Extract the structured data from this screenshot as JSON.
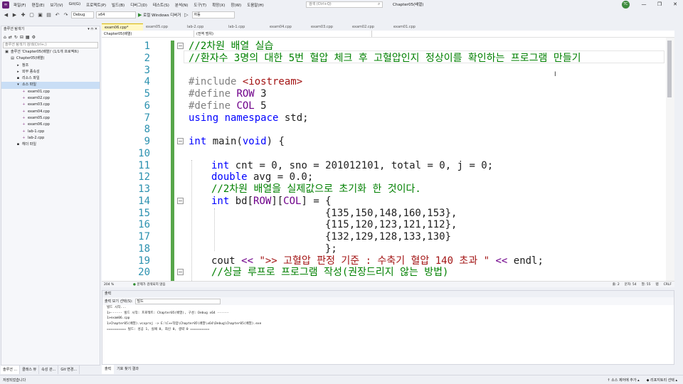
{
  "titlebar": {
    "menus": [
      "파일(F)",
      "편집(E)",
      "보기(V)",
      "Git(G)",
      "프로젝트(P)",
      "빌드(B)",
      "디버그(D)",
      "테스트(S)",
      "분석(N)",
      "도구(T)",
      "확장(X)",
      "창(W)",
      "도움말(H)"
    ],
    "search_placeholder": "검색 (Ctrl+Q)",
    "solution_name": "Chapter05(배열)",
    "avatar": "TC",
    "minimize": "—",
    "maximize": "❐",
    "close": "✕"
  },
  "toolbar": {
    "config": "Debug",
    "platform": "x64",
    "run_label": "로컬 Windows 디버거",
    "mode": "자동"
  },
  "explorer": {
    "title": "솔루션 탐색기",
    "search_placeholder": "솔루션 탐색기 검색(Ctrl+;)",
    "items": [
      {
        "label": "솔루션 'Chapter05(배열)' (1/1개 프로젝트)",
        "icon": "▣",
        "indent": 0,
        "selected": false
      },
      {
        "label": "Chapter05(배열)",
        "icon": "▤",
        "indent": 1,
        "selected": false
      },
      {
        "label": "참조",
        "icon": "▸",
        "indent": 2,
        "selected": false
      },
      {
        "label": "외부 종속성",
        "icon": "▸",
        "indent": 2,
        "selected": false
      },
      {
        "label": "리소스 파일",
        "icon": "▪",
        "indent": 2,
        "selected": false
      },
      {
        "label": "소스 파일",
        "icon": "▾",
        "indent": 2,
        "selected": true
      },
      {
        "label": "exam01.cpp",
        "icon": "+",
        "indent": 3,
        "selected": false
      },
      {
        "label": "exam02.cpp",
        "icon": "+",
        "indent": 3,
        "selected": false
      },
      {
        "label": "exam03.cpp",
        "icon": "+",
        "indent": 3,
        "selected": false
      },
      {
        "label": "exam04.cpp",
        "icon": "+",
        "indent": 3,
        "selected": false
      },
      {
        "label": "exam05.cpp",
        "icon": "+",
        "indent": 3,
        "selected": false
      },
      {
        "label": "exam06.cpp",
        "icon": "+",
        "indent": 3,
        "selected": false
      },
      {
        "label": "lab-1.cpp",
        "icon": "+",
        "indent": 3,
        "selected": false
      },
      {
        "label": "lab-2.cpp",
        "icon": "+",
        "indent": 3,
        "selected": false
      },
      {
        "label": "헤더 파일",
        "icon": "▪",
        "indent": 2,
        "selected": false
      }
    ],
    "tabs": [
      "솔루션 ...",
      "클래스 뷰",
      "속성 관...",
      "Git 변경..."
    ]
  },
  "doc_tabs": [
    "exam06.cpp*",
    "exam05.cpp",
    "lab-2.cpp",
    "lab-1.cpp",
    "exam04.cpp",
    "exam03.cpp",
    "exam02.cpp",
    "exam01.cpp"
  ],
  "nav_bar": {
    "project": "Chapter05(배열)",
    "scope": "(전역 범위)"
  },
  "editor": {
    "lines": [
      {
        "n": "1",
        "indent": 0,
        "fold": true,
        "tokens": [
          {
            "t": "//2차원 배열 실습",
            "c": "c-comment"
          }
        ]
      },
      {
        "n": "2",
        "indent": 0,
        "fold": false,
        "tokens": [
          {
            "t": "//환자수 3명의 대한 5번 혈압 체크 후 고혈압인지 정상이를 확인하는 프로그램 만들기",
            "c": "c-comment"
          }
        ]
      },
      {
        "n": "3",
        "indent": 0,
        "fold": false,
        "tokens": []
      },
      {
        "n": "4",
        "indent": 0,
        "fold": false,
        "tokens": [
          {
            "t": "#include ",
            "c": "c-pre"
          },
          {
            "t": "<iostream>",
            "c": "c-inc"
          }
        ]
      },
      {
        "n": "5",
        "indent": 0,
        "fold": false,
        "tokens": [
          {
            "t": "#define ",
            "c": "c-pre"
          },
          {
            "t": "ROW",
            "c": "c-macro"
          },
          {
            "t": " 3",
            "c": "c-plain"
          }
        ]
      },
      {
        "n": "6",
        "indent": 0,
        "fold": false,
        "tokens": [
          {
            "t": "#define ",
            "c": "c-pre"
          },
          {
            "t": "COL",
            "c": "c-macro"
          },
          {
            "t": " 5",
            "c": "c-plain"
          }
        ]
      },
      {
        "n": "7",
        "indent": 0,
        "fold": false,
        "tokens": [
          {
            "t": "using namespace",
            "c": "c-kw"
          },
          {
            "t": " std;",
            "c": "c-plain"
          }
        ]
      },
      {
        "n": "8",
        "indent": 0,
        "fold": false,
        "tokens": []
      },
      {
        "n": "9",
        "indent": 0,
        "fold": true,
        "tokens": [
          {
            "t": "int",
            "c": "c-kw"
          },
          {
            "t": " main(",
            "c": "c-plain"
          },
          {
            "t": "void",
            "c": "c-kw"
          },
          {
            "t": ") {",
            "c": "c-plain"
          }
        ]
      },
      {
        "n": "10",
        "indent": 0,
        "fold": false,
        "tokens": []
      },
      {
        "n": "11",
        "indent": 1,
        "fold": false,
        "tokens": [
          {
            "t": "int",
            "c": "c-kw"
          },
          {
            "t": " cnt = 0, sno = 201012101, total = 0, j = 0;",
            "c": "c-plain"
          }
        ]
      },
      {
        "n": "12",
        "indent": 1,
        "fold": false,
        "tokens": [
          {
            "t": "double",
            "c": "c-kw"
          },
          {
            "t": " avg = 0.0;",
            "c": "c-plain"
          }
        ]
      },
      {
        "n": "13",
        "indent": 1,
        "fold": false,
        "tokens": [
          {
            "t": "//2차원 배열을 실제값으로 초기화 한 것이다.",
            "c": "c-comment"
          }
        ]
      },
      {
        "n": "14",
        "indent": 1,
        "fold": true,
        "tokens": [
          {
            "t": "int",
            "c": "c-kw"
          },
          {
            "t": " bd[",
            "c": "c-plain"
          },
          {
            "t": "ROW",
            "c": "c-macro"
          },
          {
            "t": "][",
            "c": "c-plain"
          },
          {
            "t": "COL",
            "c": "c-macro"
          },
          {
            "t": "] = {",
            "c": "c-plain"
          }
        ]
      },
      {
        "n": "15",
        "indent": 6,
        "fold": false,
        "tokens": [
          {
            "t": "{135,150,148,160,153},",
            "c": "c-plain"
          }
        ]
      },
      {
        "n": "16",
        "indent": 6,
        "fold": false,
        "tokens": [
          {
            "t": "{115,120,123,121,112},",
            "c": "c-plain"
          }
        ]
      },
      {
        "n": "17",
        "indent": 6,
        "fold": false,
        "tokens": [
          {
            "t": "{132,129,128,133,130}",
            "c": "c-plain"
          }
        ]
      },
      {
        "n": "18",
        "indent": 6,
        "fold": false,
        "tokens": [
          {
            "t": "};",
            "c": "c-plain"
          }
        ]
      },
      {
        "n": "19",
        "indent": 1,
        "fold": false,
        "tokens": [
          {
            "t": "cout ",
            "c": "c-plain"
          },
          {
            "t": "<<",
            "c": "c-macro"
          },
          {
            "t": " \">> 고혈압 판정 기준 : 수축기 혈압 140 초과 \" ",
            "c": "c-str"
          },
          {
            "t": "<<",
            "c": "c-macro"
          },
          {
            "t": " endl;",
            "c": "c-plain"
          }
        ]
      },
      {
        "n": "20",
        "indent": 1,
        "fold": true,
        "tokens": [
          {
            "t": "//싱글 루프로 프로그램 작성(권장드리지 않는 방법)",
            "c": "c-comment"
          }
        ]
      }
    ]
  },
  "editor_status": {
    "zoom": "204 %",
    "issues": "문제가 검색되지 않음",
    "line": "줄: 2",
    "col": "문자: 54",
    "space": "열: 55",
    "tab": "탭",
    "eol": "CRLF"
  },
  "output": {
    "title": "출력",
    "source_label": "출력 보기 선택(S):",
    "source_value": "빌드",
    "lines": [
      "빌드 시작...",
      "1>------ 빌드 시작: 프로젝트: Chapter05(배열), 구성: Debug x64 ------",
      "1>exam06.cpp",
      "1>Chapter05(배열).vcxproj -> E:\\C++작업\\Chapter05\\배열\\x64\\Debug\\Chapter05(배열).exe",
      "========== 빌드: 성공 1, 실패 0, 최신 0, 생략 0 =========="
    ],
    "tabs": [
      "출력",
      "기호 찾기 결과"
    ]
  },
  "statusbar": {
    "left": "저장되었습니다",
    "source_control": "↑ 소스 제어에 추가 ▴",
    "repo": "◆ 리포지토리 선택 ▴"
  }
}
